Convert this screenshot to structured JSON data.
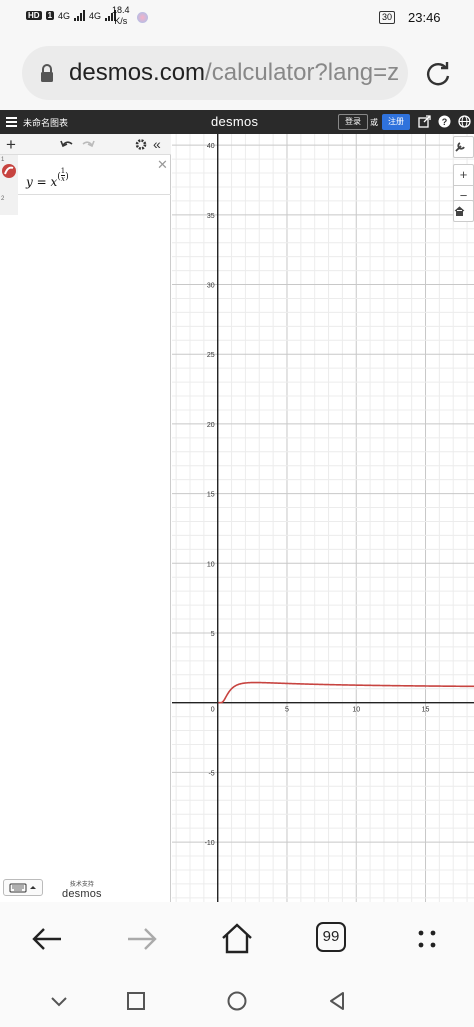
{
  "status_bar": {
    "hd_badge": "HD",
    "sim1": "1",
    "network1": "4G",
    "network2": "4G",
    "speed_value": "18.4",
    "speed_unit": "K/s",
    "battery": "30",
    "time": "23:46"
  },
  "browser": {
    "url_host": "desmos.com",
    "url_path": "/calculator?lang=z",
    "lock_icon": "lock-icon",
    "reload_icon": "reload-icon"
  },
  "desmos_header": {
    "menu_icon": "hamburger-icon",
    "graph_title": "未命名图表",
    "brand": "desmos",
    "login_label": "登录",
    "or_label": "或",
    "signup_label": "注册",
    "icons": [
      "share-icon",
      "help-icon",
      "globe-icon"
    ],
    "signup_color": "#2f72dc"
  },
  "expression_panel": {
    "toolbar_icons": [
      "add-icon",
      "undo-icon",
      "redo-icon",
      "gear-icon",
      "collapse-icon"
    ],
    "expressions": [
      {
        "index": "1",
        "latex_plain": "y = x^(1/x)",
        "color": "#c74440"
      }
    ],
    "empty_row_index": "2",
    "keyboard_icon": "keyboard-icon",
    "powered_by": "技术支持",
    "powered_brand": "desmos"
  },
  "graph": {
    "x_ticks": [
      "0",
      "5",
      "10",
      "15"
    ],
    "y_ticks": [
      "40",
      "35",
      "30",
      "25",
      "20",
      "15",
      "10",
      "5",
      "-5",
      "-10"
    ],
    "xlim": [
      -3.3,
      18.5
    ],
    "ylim": [
      -14.3,
      40.8
    ],
    "curve_color": "#c74440",
    "controls": [
      "wrench-icon",
      "zoom-in-icon",
      "zoom-out-icon",
      "home-icon"
    ]
  },
  "nav": {
    "back_icon": "back-arrow-icon",
    "forward_icon": "forward-arrow-icon",
    "home_icon": "home-icon",
    "tabs_count": "99",
    "more_icon": "more-dots-icon"
  },
  "system_nav": [
    "system-back-icon",
    "system-home-icon",
    "system-recents-icon",
    "system-down-icon"
  ]
}
